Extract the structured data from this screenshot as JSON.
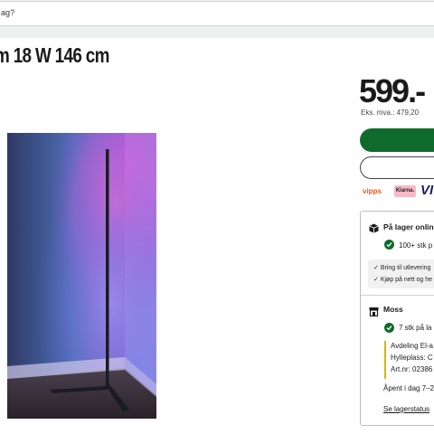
{
  "search": {
    "value": "ag?"
  },
  "product": {
    "title": "m 18 W 146 cm"
  },
  "price": {
    "amount": "599.-",
    "ex_vat": "Eks. mva.: 479,20"
  },
  "payment": {
    "vipps": "vipps",
    "klarna": "Klarna.",
    "visa": "VI"
  },
  "stock": {
    "online_title": "På lager online",
    "online_count": "100+ stk p",
    "delivery_lines": [
      "Bring til utlevering",
      "Kjøp på nett og he"
    ],
    "store_name": "Moss",
    "store_count": "7 stk på la",
    "location_lines": [
      "Avdeling El-a",
      "Hylleplass: C",
      "Art.nr: 02386"
    ],
    "opening_hours": "Åpent i dag 7–2",
    "status_link": "Se lagerstatus"
  },
  "colors": {
    "brand_green": "#0f6b2d",
    "accent_yellow": "#e0b100"
  }
}
